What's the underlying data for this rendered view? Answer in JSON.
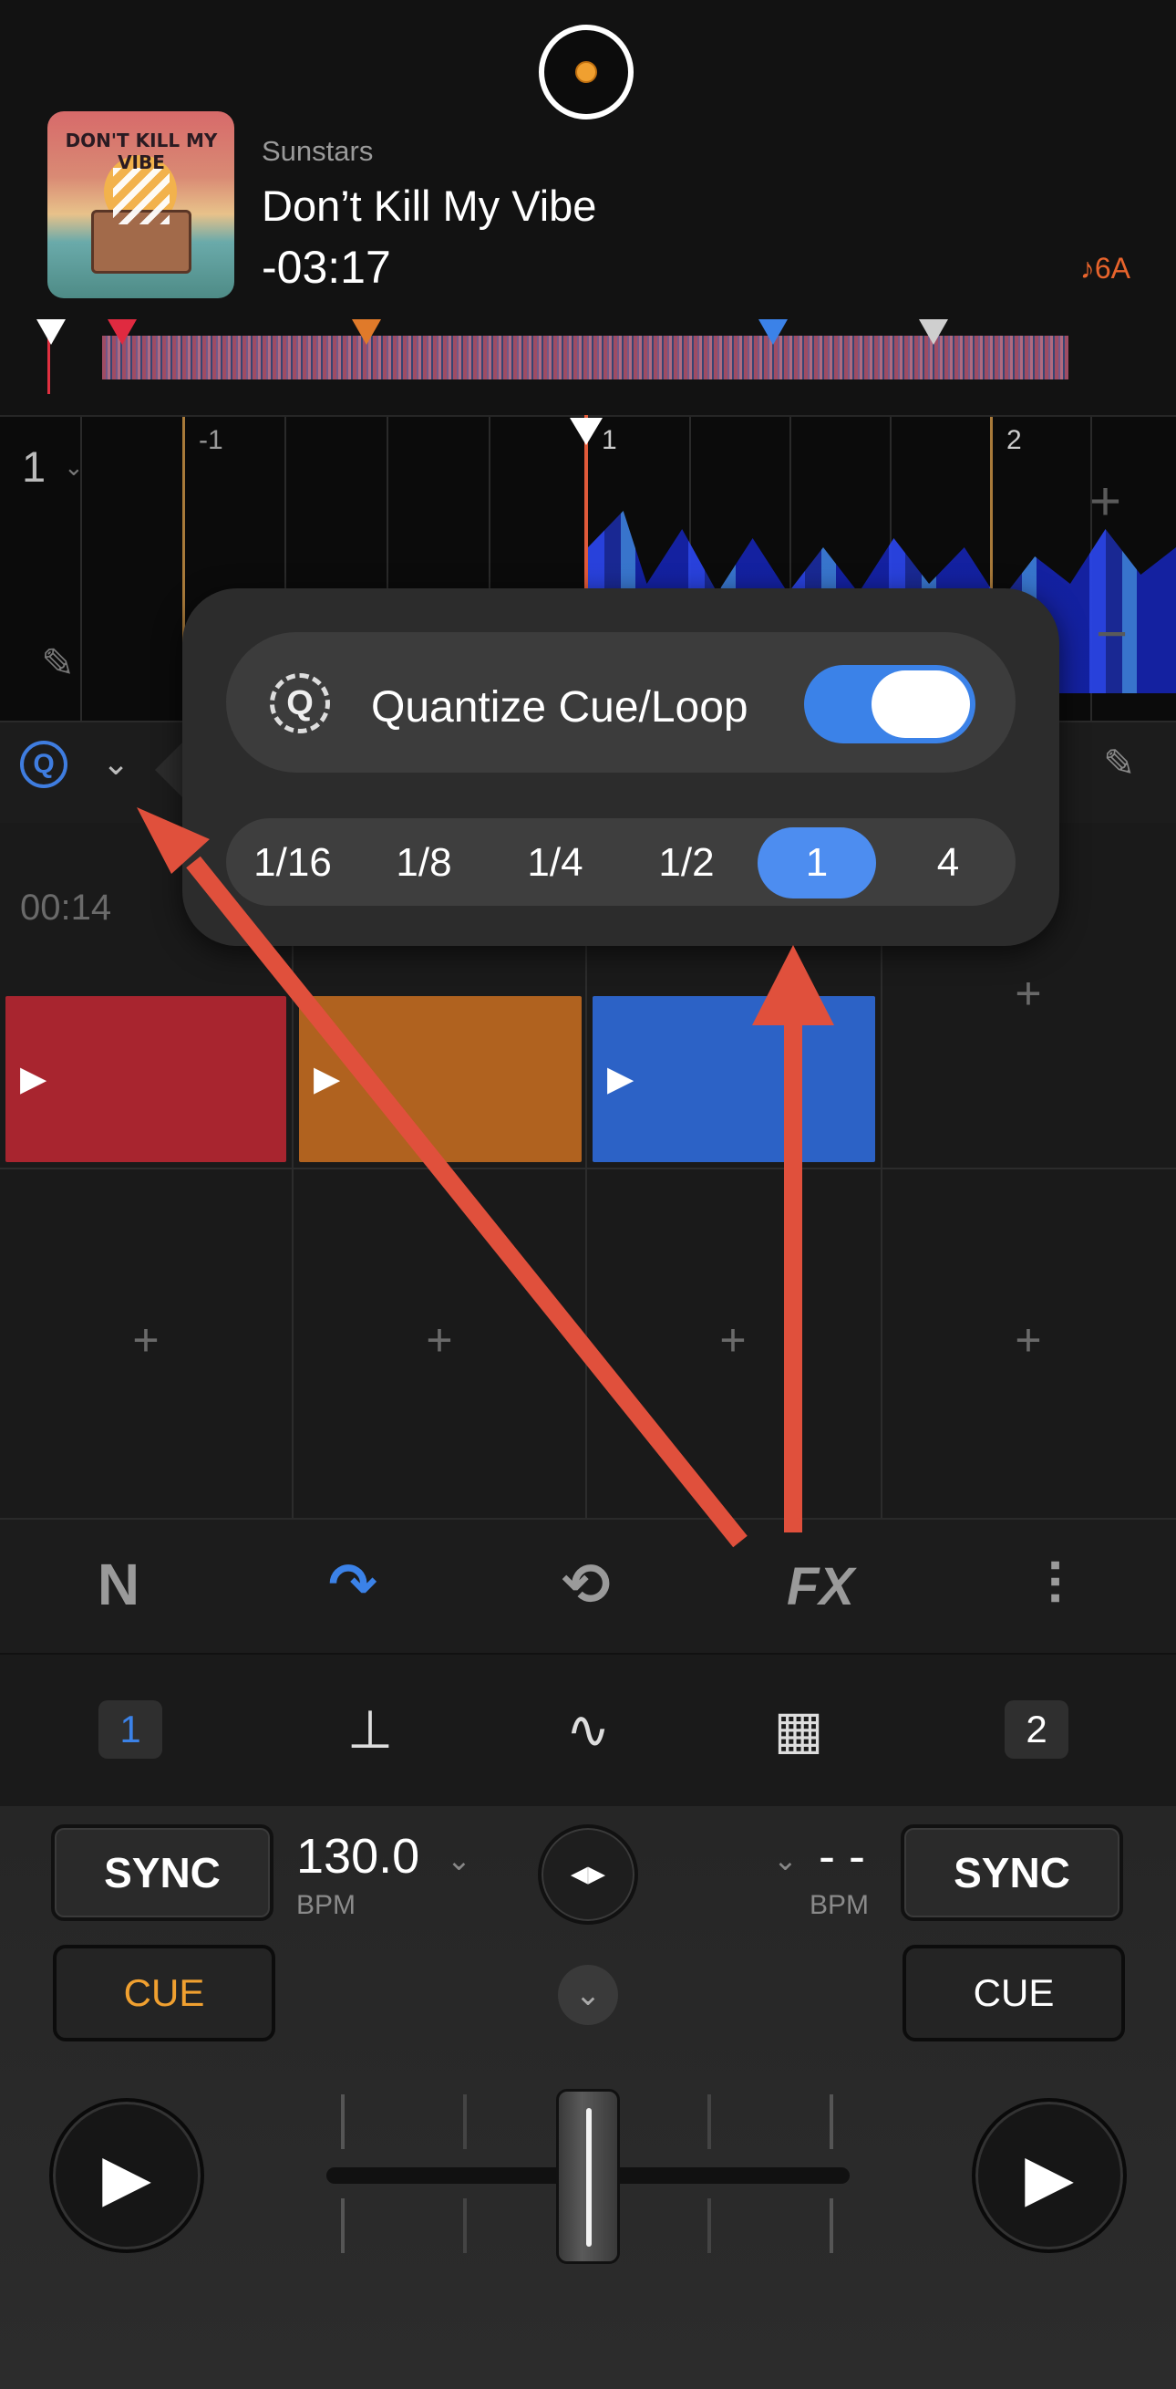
{
  "header": {
    "artist": "Sunstars",
    "title": "Don’t Kill My Vibe",
    "time_remaining": "-03:17",
    "key": "♪6A",
    "artwork_text": "DON'T KILL MY VIBE"
  },
  "waveform": {
    "deck_number": "1",
    "deck_chevron": "⌄",
    "beat_labels": [
      "-1",
      "1",
      "2"
    ],
    "zoom_in": "+",
    "zoom_out": "−",
    "edit_icon": "✎"
  },
  "quantize_row": {
    "icon_letter": "Q",
    "chevron": "⌄",
    "edit_icon": "✎"
  },
  "popover": {
    "icon_letter": "Q",
    "label": "Quantize Cue/Loop",
    "toggle_on": true,
    "options": [
      "1/16",
      "1/8",
      "1/4",
      "1/2",
      "1",
      "4"
    ],
    "selected": "1"
  },
  "pads": {
    "time": "00:14",
    "row1": [
      {
        "type": "cue",
        "color": "#a8252f"
      },
      {
        "type": "cue",
        "color": "#b0621f"
      },
      {
        "type": "cue",
        "color": "#2c62c6"
      },
      {
        "type": "empty"
      }
    ],
    "play_symbol": "▶",
    "add_symbol": "+"
  },
  "mode_bar": {
    "icons": [
      "neural-mix-icon",
      "automix-icon",
      "loop-icon",
      "fx-icon",
      "eq-sliders-icon"
    ],
    "glyphs": [
      "N",
      "↷",
      "⟲",
      "FX",
      "⫶"
    ],
    "active": "automix-icon",
    "accent": "#3b82e8"
  },
  "deck_bar": {
    "left_deck": "1",
    "right_deck": "2"
  },
  "mixer": {
    "sync_label": "SYNC",
    "cue_label": "CUE",
    "bpm_left": "130.0",
    "bpm_right": "- -",
    "bpm_unit": "BPM",
    "cue_left_color": "#f0a030"
  }
}
